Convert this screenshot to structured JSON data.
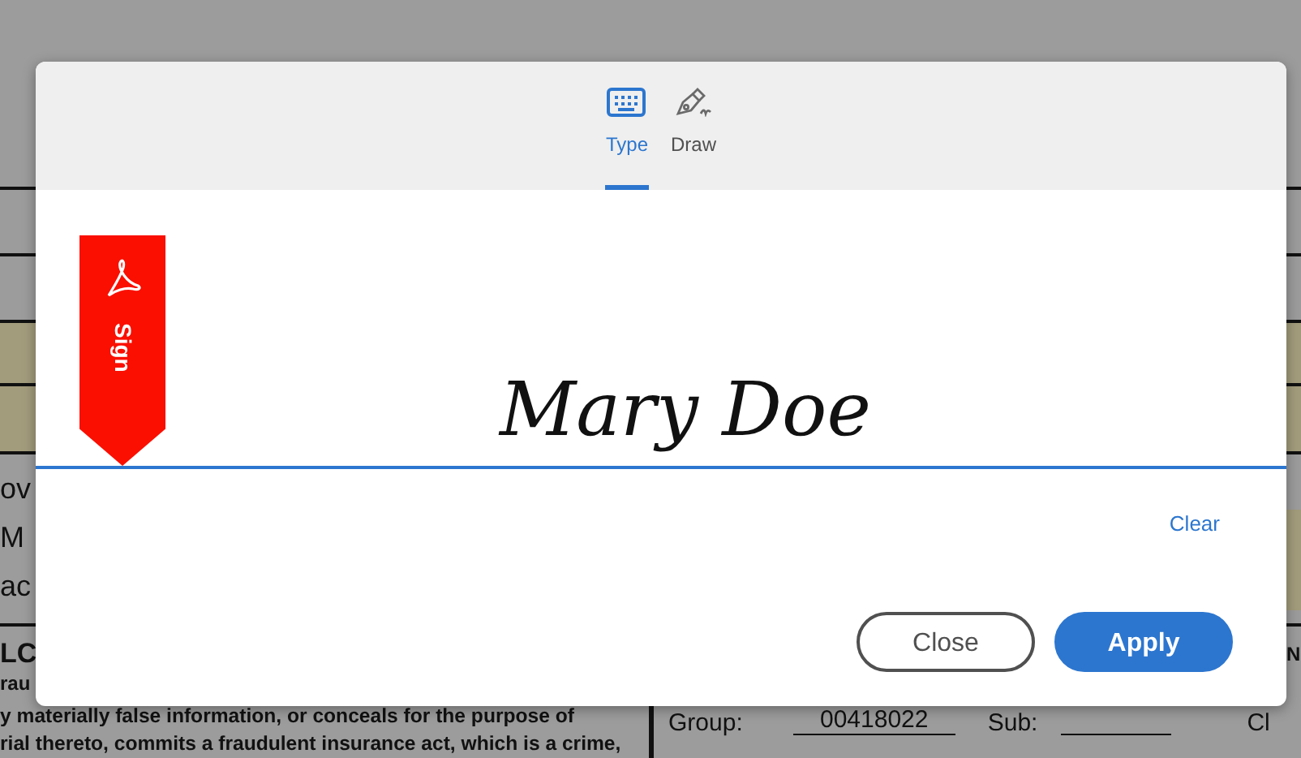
{
  "document": {
    "side_lines": [
      "ov",
      "M",
      "ac"
    ],
    "heading_fragment": "LC",
    "subheading_fragment": "rau",
    "right_heading_fragment": "N",
    "notice_lines": [
      "y materially false information, or conceals for the purpose of",
      "rial thereto, commits a fraudulent insurance act, which is a crime,"
    ],
    "fields": [
      {
        "label": "Group:",
        "value": "00418022"
      },
      {
        "label": "Sub:"
      }
    ],
    "trailing_label": "Cl"
  },
  "dialog": {
    "tabs": [
      {
        "label": "Type",
        "kind": "typed",
        "selected": true
      },
      {
        "label": "Draw",
        "kind": "drawn",
        "selected": false
      }
    ],
    "ribbon": {
      "label": "Sign"
    },
    "signature": "Mary Doe",
    "clear": "Clear",
    "buttons": [
      {
        "label": "Close",
        "kind": "secondary"
      },
      {
        "label": "Apply",
        "kind": "primary"
      }
    ]
  }
}
